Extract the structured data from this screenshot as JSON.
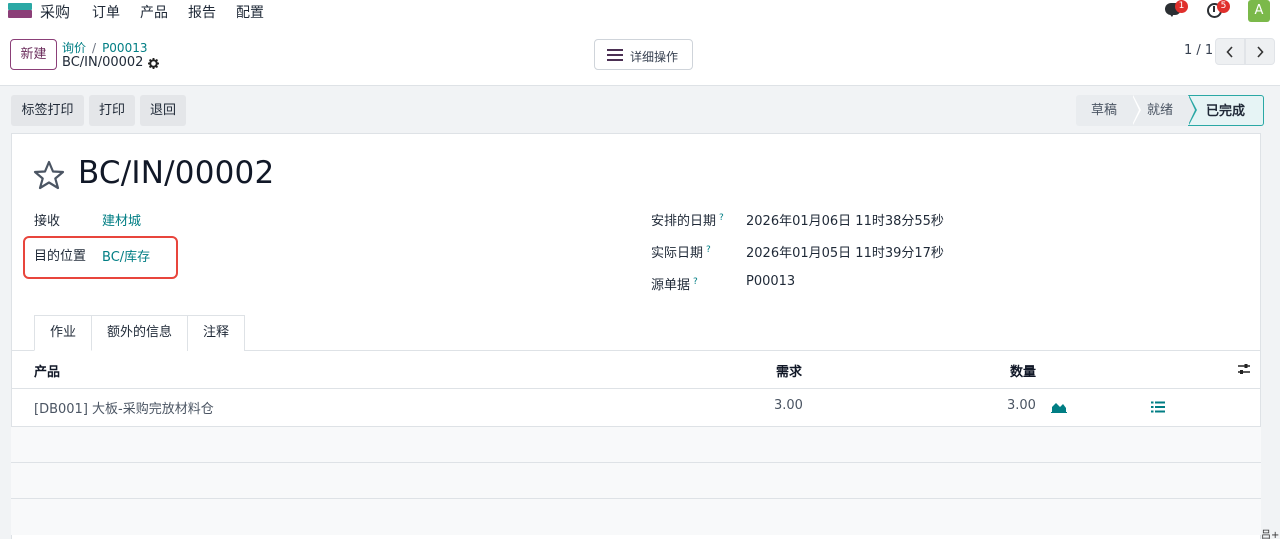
{
  "app": {
    "name": "采购",
    "logo_icon": "app-logo-icon"
  },
  "top_menu": [
    "订单",
    "产品",
    "报告",
    "配置"
  ],
  "systray": {
    "messages_count": "1",
    "activities_count": "5",
    "user_initial": "A"
  },
  "control": {
    "new_button": "新建",
    "breadcrumb": [
      "询价",
      "P00013"
    ],
    "record_name": "BC/IN/00002",
    "actions_button": "详细操作",
    "pager": "1 / 1"
  },
  "action_buttons": [
    "标签打印",
    "打印",
    "退回"
  ],
  "stages": [
    {
      "label": "草稿",
      "active": false
    },
    {
      "label": "就绪",
      "active": false
    },
    {
      "label": "已完成",
      "active": true
    }
  ],
  "record": {
    "title": "BC/IN/00002",
    "fields_left": [
      {
        "label": "接收",
        "value": "建材城",
        "link": true
      },
      {
        "label": "目的位置",
        "value": "BC/库存",
        "link": true
      }
    ],
    "fields_right": [
      {
        "label": "安排的日期",
        "help": "?",
        "value": "2026年01月06日 11时38分55秒"
      },
      {
        "label": "实际日期",
        "help": "?",
        "value": "2026年01月05日 11时39分17秒"
      },
      {
        "label": "源单据",
        "help": "?",
        "value": "P00013"
      }
    ]
  },
  "tabs": [
    {
      "label": "作业",
      "active": true
    },
    {
      "label": "额外的信息",
      "active": false
    },
    {
      "label": "注释",
      "active": false
    }
  ],
  "table": {
    "headers": {
      "product": "产品",
      "demand": "需求",
      "quantity": "数量"
    },
    "rows": [
      {
        "product": "[DB001] 大板-采购完放材料仓",
        "demand": "3.00",
        "quantity": "3.00"
      }
    ]
  },
  "corner_glyph": "吕+",
  "colors": {
    "brand": "#8b3f78",
    "link": "#017e84",
    "highlight": "#e8453c",
    "badge": "#e0302c"
  }
}
